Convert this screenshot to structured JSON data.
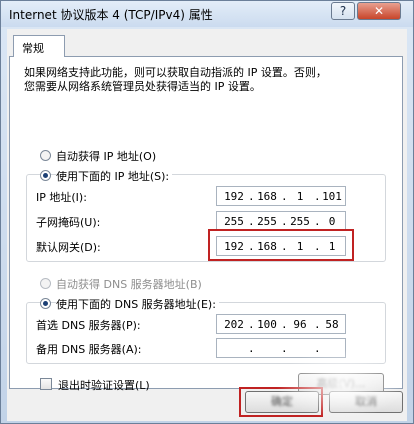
{
  "window": {
    "title": "Internet 协议版本 4 (TCP/IPv4) 属性",
    "help_label": "?",
    "close_label": "✕"
  },
  "tab": {
    "label": "常规"
  },
  "intro": {
    "line1": "如果网络支持此功能，则可以获取自动指派的 IP 设置。否则，",
    "line2": "您需要从网络系统管理员处获得适当的 IP 设置。"
  },
  "ip_mode": {
    "auto_label": "自动获得 IP 地址(O)",
    "manual_label": "使用下面的 IP 地址(S):",
    "selected": "manual"
  },
  "ip_fields": [
    {
      "label": "IP 地址(I):",
      "octets": [
        "192",
        "168",
        "1",
        "101"
      ]
    },
    {
      "label": "子网掩码(U):",
      "octets": [
        "255",
        "255",
        "255",
        "0"
      ]
    },
    {
      "label": "默认网关(D):",
      "octets": [
        "192",
        "168",
        "1",
        "1"
      ],
      "highlighted": true
    }
  ],
  "dns_mode": {
    "auto_label": "自动获得 DNS 服务器地址(B)",
    "auto_enabled": false,
    "manual_label": "使用下面的 DNS 服务器地址(E):",
    "selected": "manual"
  },
  "dns_fields": [
    {
      "label": "首选 DNS 服务器(P):",
      "octets": [
        "202",
        "100",
        "96",
        "58"
      ]
    },
    {
      "label": "备用 DNS 服务器(A):",
      "octets": [
        "",
        "",
        "",
        ""
      ]
    }
  ],
  "validate": {
    "label": "退出时验证设置(L)",
    "checked": false
  },
  "advanced_label": "高级(V)...",
  "ok_label": "确定",
  "cancel_label": "取消",
  "colors": {
    "highlight": "#c02222"
  }
}
